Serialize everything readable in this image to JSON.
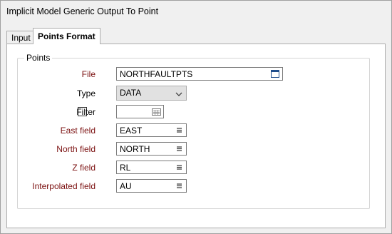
{
  "window": {
    "title": "Implicit Model Generic Output To Point"
  },
  "tabs": [
    {
      "label": "Input"
    },
    {
      "label": "Points Format"
    }
  ],
  "group": {
    "title": "Points"
  },
  "form": {
    "file": {
      "label": "File",
      "value": "NORTHFAULTPTS"
    },
    "type": {
      "label": "Type",
      "value": "DATA"
    },
    "filter": {
      "label": "Filter",
      "value": "",
      "checked": false
    },
    "east": {
      "label": "East field",
      "value": "EAST"
    },
    "north": {
      "label": "North field",
      "value": "NORTH"
    },
    "z": {
      "label": "Z field",
      "value": "RL"
    },
    "interp": {
      "label": "Interpolated field",
      "value": "AU"
    }
  },
  "colors": {
    "required_label": "#7b1010",
    "panel_bg": "#ffffff",
    "window_bg": "#f0f0f0"
  },
  "icons": {
    "file_browse": "file-browse-icon",
    "type_dropdown": "chevron-down-icon",
    "filter_browse": "filter-calendar-icon",
    "field_list": "list-icon"
  }
}
